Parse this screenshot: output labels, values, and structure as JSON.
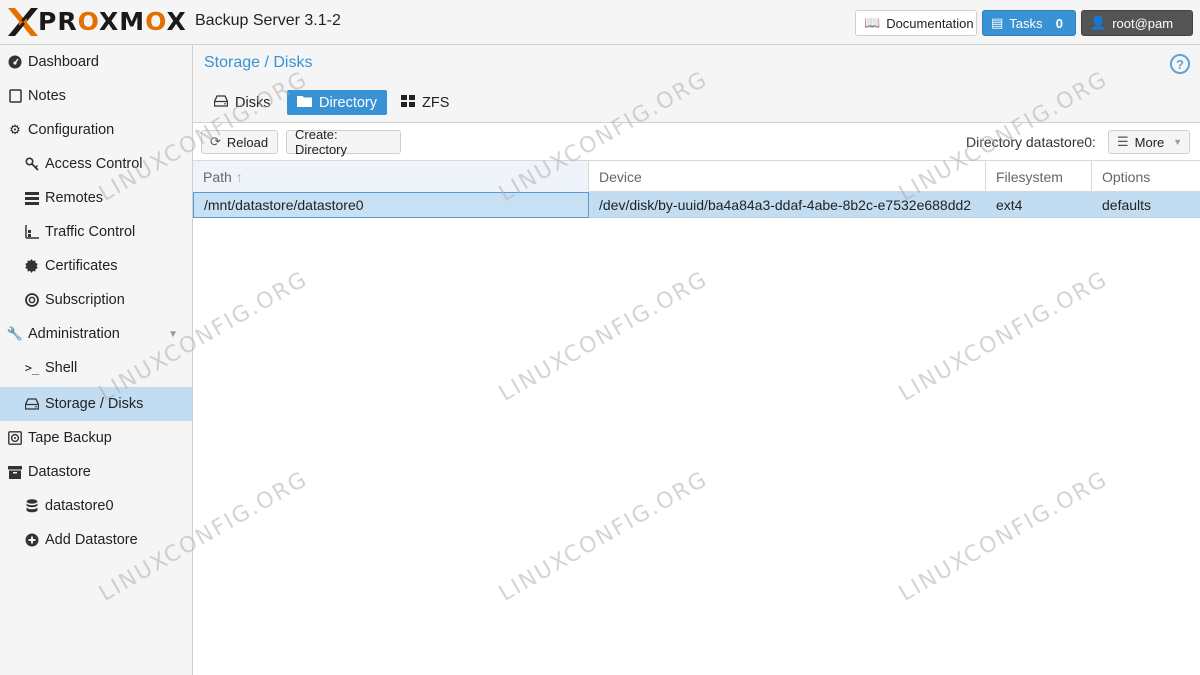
{
  "header": {
    "logo_prefix": "PR",
    "logo_o1": "O",
    "logo_mid": "XM",
    "logo_o2": "O",
    "logo_suffix": "X",
    "version": "Backup Server 3.1-2",
    "documentation_label": "Documentation",
    "tasks_label": "Tasks",
    "tasks_count": "0",
    "user_label": "root@pam"
  },
  "sidebar": {
    "items": [
      {
        "label": "Dashboard",
        "icon": "dashboard-icon"
      },
      {
        "label": "Notes",
        "icon": "note-icon"
      },
      {
        "label": "Configuration",
        "icon": "gears-icon"
      },
      {
        "label": "Access Control",
        "icon": "key-icon"
      },
      {
        "label": "Remotes",
        "icon": "server-icon"
      },
      {
        "label": "Traffic Control",
        "icon": "bar-chart-icon"
      },
      {
        "label": "Certificates",
        "icon": "certificate-icon"
      },
      {
        "label": "Subscription",
        "icon": "support-icon"
      },
      {
        "label": "Administration",
        "icon": "wrench-icon"
      },
      {
        "label": "Shell",
        "icon": "terminal-icon"
      },
      {
        "label": "Storage / Disks",
        "icon": "hdd-icon"
      },
      {
        "label": "Tape Backup",
        "icon": "tape-icon"
      },
      {
        "label": "Datastore",
        "icon": "archive-icon"
      },
      {
        "label": "datastore0",
        "icon": "database-icon"
      },
      {
        "label": "Add Datastore",
        "icon": "plus-circle-icon"
      }
    ]
  },
  "main": {
    "breadcrumb": "Storage / Disks",
    "help_glyph": "?",
    "tabs": [
      {
        "label": "Disks",
        "icon": "hdd-icon"
      },
      {
        "label": "Directory",
        "icon": "folder-icon"
      },
      {
        "label": "ZFS",
        "icon": "th-large-icon"
      }
    ],
    "toolbar": {
      "reload_label": "Reload",
      "create_label": "Create: Directory",
      "context_label": "Directory datastore0:",
      "more_label": "More"
    },
    "grid": {
      "columns": [
        "Path",
        "Device",
        "Filesystem",
        "Options"
      ],
      "rows": [
        {
          "path": "/mnt/datastore/datastore0",
          "device": "/dev/disk/by-uuid/ba4a84a3-ddaf-4abe-8b2c-e7532e688dd2",
          "filesystem": "ext4",
          "options": "defaults"
        }
      ]
    }
  },
  "watermark": "LINUXCONFIG.ORG",
  "colors": {
    "accent": "#3892d4",
    "selection": "#c2ddf2",
    "logo_orange": "#e57000"
  }
}
